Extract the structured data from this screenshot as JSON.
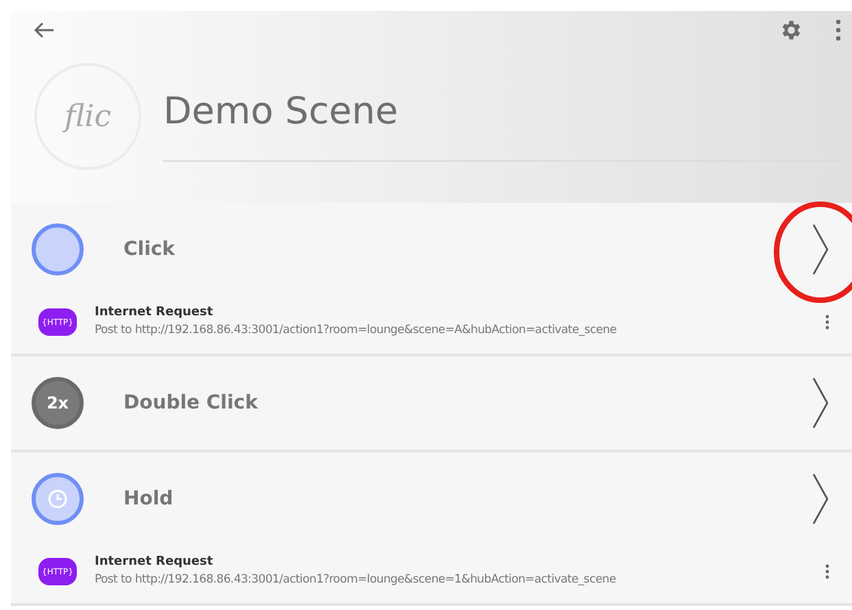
{
  "header": {
    "logo": "flic",
    "title": "Demo Scene"
  },
  "triggers": [
    {
      "kind": "click",
      "label": "Click",
      "highlighted": true,
      "actions": [
        {
          "badge": "{HTTP}",
          "title": "Internet Request",
          "detail": "Post to http://192.168.86.43:3001/action1?room=lounge&scene=A&hubAction=activate_scene"
        }
      ]
    },
    {
      "kind": "double",
      "icon_text": "2x",
      "label": "Double Click",
      "highlighted": false
    },
    {
      "kind": "hold",
      "label": "Hold",
      "highlighted": false,
      "actions": [
        {
          "badge": "{HTTP}",
          "title": "Internet Request",
          "detail": "Post to http://192.168.86.43:3001/action1?room=lounge&scene=1&hubAction=activate_scene"
        }
      ]
    }
  ]
}
